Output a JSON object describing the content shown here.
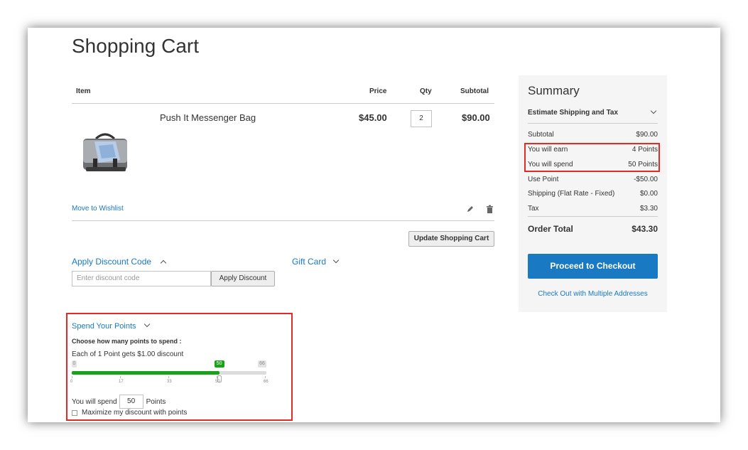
{
  "page": {
    "title": "Shopping Cart"
  },
  "cart_table": {
    "headers": {
      "item": "Item",
      "price": "Price",
      "qty": "Qty",
      "subtotal": "Subtotal"
    },
    "item": {
      "name": "Push It Messenger Bag",
      "price": "$45.00",
      "qty": "2",
      "subtotal": "$90.00"
    },
    "move_to_wishlist": "Move to Wishlist",
    "update_cart": "Update Shopping Cart"
  },
  "discount": {
    "title": "Apply Discount Code",
    "placeholder": "Enter discount code",
    "apply": "Apply Discount",
    "gift_card": "Gift Card"
  },
  "points": {
    "title": "Spend Your Points",
    "choose_label": "Choose how many points to spend :",
    "rate_text": "Each of 1 Point gets $1.00 discount",
    "slider": {
      "min": "0",
      "max": "66",
      "value": "50",
      "ticks": [
        "0",
        "17",
        "33",
        "50",
        "66"
      ],
      "fraction": 0.7576
    },
    "spend_prefix": "You will spend",
    "spend_value": "50",
    "spend_suffix": "Points",
    "maximize_label": "Maximize my discount with points"
  },
  "summary": {
    "title": "Summary",
    "estimate": "Estimate Shipping and Tax",
    "rows": [
      {
        "label": "Subtotal",
        "value": "$90.00"
      },
      {
        "label": "You will earn",
        "value": "4 Points"
      },
      {
        "label": "You will spend",
        "value": "50 Points"
      },
      {
        "label": "Use Point",
        "value": "-$50.00"
      },
      {
        "label": "Shipping (Flat Rate - Fixed)",
        "value": "$0.00"
      },
      {
        "label": "Tax",
        "value": "$3.30"
      }
    ],
    "order_total_label": "Order Total",
    "order_total_value": "$43.30",
    "checkout": "Proceed to Checkout",
    "multi_address": "Check Out with Multiple Addresses"
  },
  "colors": {
    "accent": "#1979c3",
    "highlight": "#e02b27",
    "slider": "#1aa31a"
  },
  "icons": [
    "edit-icon",
    "trash-icon",
    "chevron-up-icon",
    "chevron-down-icon"
  ]
}
